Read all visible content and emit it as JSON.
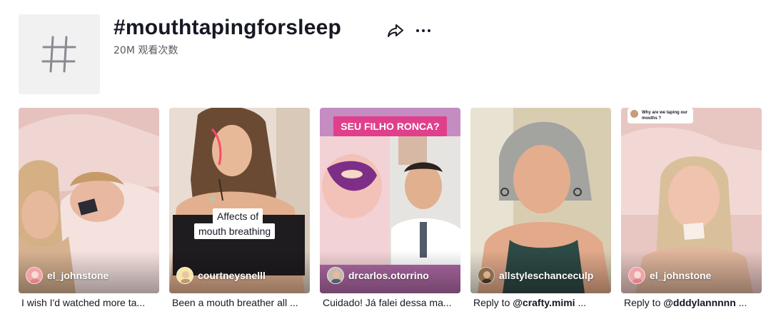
{
  "header": {
    "title": "#mouthtapingforsleep",
    "views": "20M 观看次数",
    "hashtag_icon": "hashtag-icon",
    "share_icon": "share-icon",
    "more_icon": "more-dots-icon"
  },
  "videos": [
    {
      "author": "el_johnstone",
      "caption": "I wish I'd watched more ta...",
      "overlay": ""
    },
    {
      "author": "courtneysnelll",
      "caption": "Been a mouth breather all ...",
      "overlay_line1": "Affects of",
      "overlay_line2": "mouth breathing"
    },
    {
      "author": "drcarlos.otorrino",
      "caption": "Cuidado! Já falei dessa ma...",
      "banner": "SEU FILHO RONCA?"
    },
    {
      "author": "allstyleschanceculp",
      "caption_prefix": "Reply to ",
      "caption_mention": "@crafty.mimi",
      "caption_suffix": " ..."
    },
    {
      "author": "el_johnstone",
      "caption_prefix": "Reply to ",
      "caption_mention": "@dddylannnnn",
      "caption_suffix": " ...",
      "question_line1": "Why are we taping our",
      "question_line2": "mouths ?"
    }
  ],
  "colors": {
    "text_primary": "#161823",
    "text_secondary": "#57585f",
    "banner_pink": "#e03f8c"
  }
}
